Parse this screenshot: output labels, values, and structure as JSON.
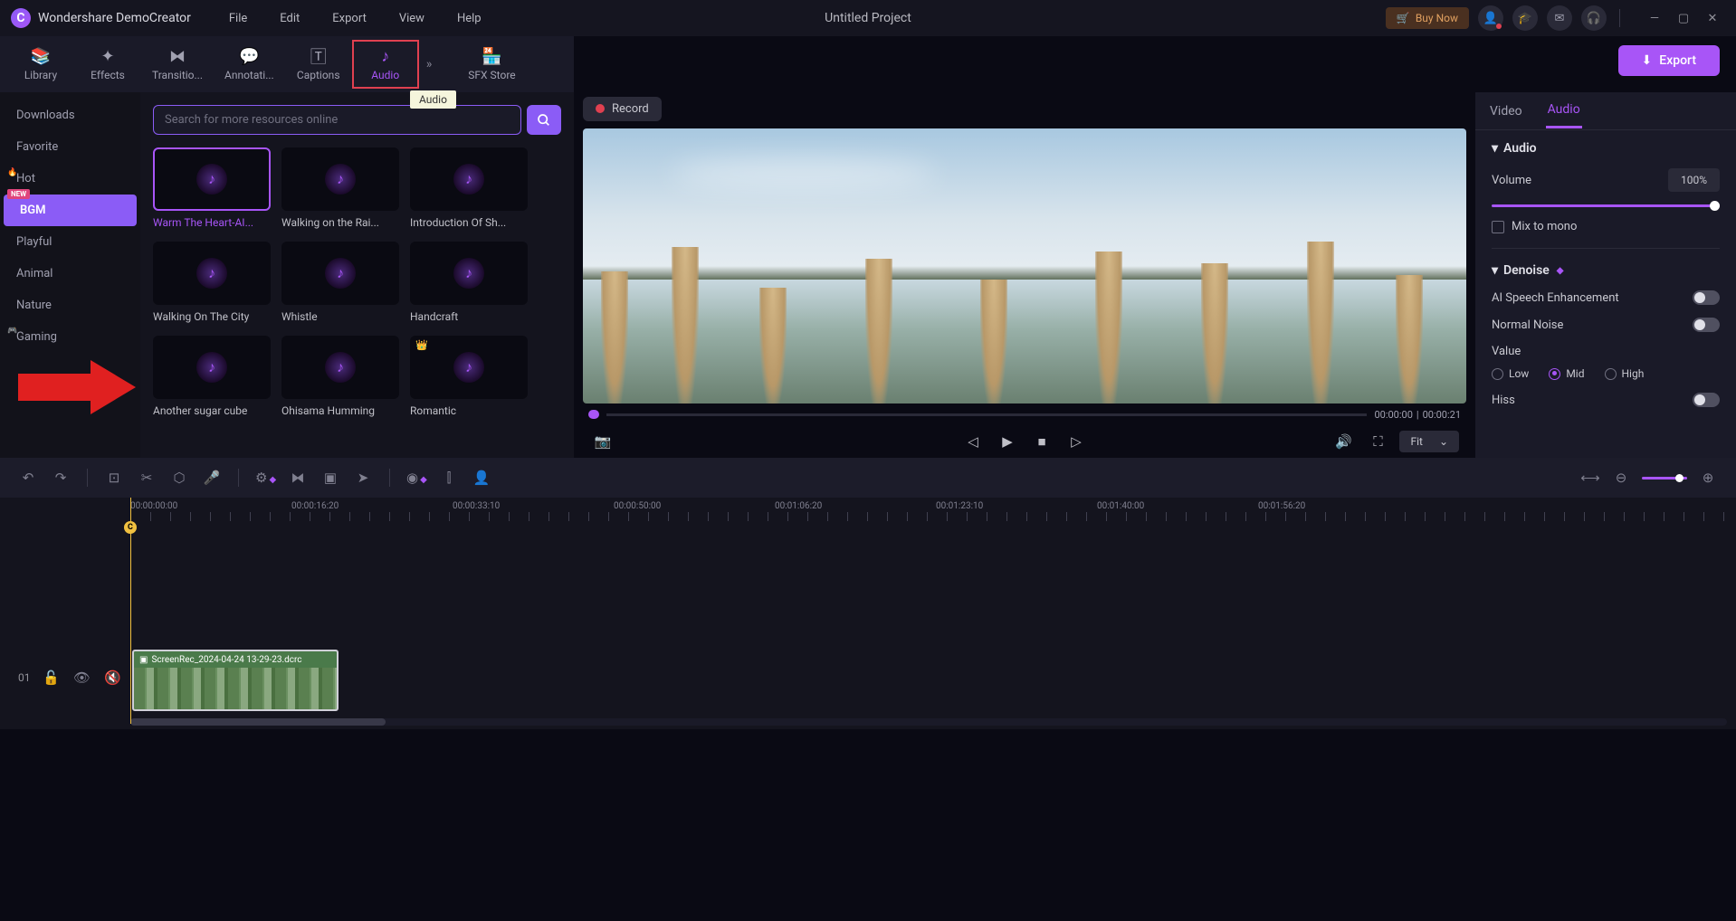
{
  "app": {
    "name": "Wondershare DemoCreator",
    "project_title": "Untitled Project"
  },
  "menu": {
    "file": "File",
    "edit": "Edit",
    "export": "Export",
    "view": "View",
    "help": "Help"
  },
  "titlebar": {
    "buy_now": "Buy Now"
  },
  "tooltab": {
    "library": "Library",
    "effects": "Effects",
    "transitions": "Transitio...",
    "annotations": "Annotati...",
    "captions": "Captions",
    "audio": "Audio",
    "sfx": "SFX Store"
  },
  "tooltip": {
    "audio": "Audio"
  },
  "categories": {
    "downloads": "Downloads",
    "favorite": "Favorite",
    "hot": "Hot",
    "bgm": "BGM",
    "playful": "Playful",
    "animal": "Animal",
    "nature": "Nature",
    "gaming": "Gaming",
    "new_badge": "NEW"
  },
  "search": {
    "placeholder": "Search for more resources online"
  },
  "assets": [
    {
      "label": "Warm The Heart-AI...",
      "selected": true
    },
    {
      "label": "Walking on the Rai..."
    },
    {
      "label": "Introduction Of Sh..."
    },
    {
      "label": "Walking On The City"
    },
    {
      "label": "Whistle"
    },
    {
      "label": "Handcraft"
    },
    {
      "label": "Another sugar cube"
    },
    {
      "label": "Ohisama Humming"
    },
    {
      "label": "Romantic",
      "crown": true
    }
  ],
  "record": {
    "label": "Record"
  },
  "export_btn": {
    "label": "Export"
  },
  "preview": {
    "time_current": "00:00:00",
    "time_total": "00:00:21",
    "fit": "Fit"
  },
  "prop_tabs": {
    "video": "Video",
    "audio": "Audio"
  },
  "props": {
    "audio_head": "Audio",
    "volume_label": "Volume",
    "volume_value": "100%",
    "mixmono": "Mix to mono",
    "denoise_head": "Denoise",
    "ai_speech": "AI Speech Enhancement",
    "normal_noise": "Normal Noise",
    "value_label": "Value",
    "low": "Low",
    "mid": "Mid",
    "high": "High",
    "hiss": "Hiss"
  },
  "timeline": {
    "ticks": [
      "00:00:00:00",
      "00:00:16:20",
      "00:00:33:10",
      "00:00:50:00",
      "00:01:06:20",
      "00:01:23:10",
      "00:01:40:00",
      "00:01:56:20"
    ],
    "track_num": "01",
    "clip_name": "ScreenRec_2024-04-24 13-29-23.dcrc"
  }
}
